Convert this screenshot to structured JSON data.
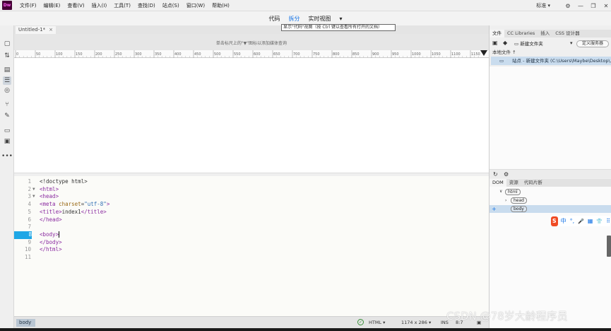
{
  "menubar": {
    "logo": "Dw",
    "items": [
      "文件(F)",
      "编辑(E)",
      "查看(V)",
      "插入(I)",
      "工具(T)",
      "查找(D)",
      "站点(S)",
      "窗口(W)",
      "帮助(H)"
    ],
    "workspace": "标准",
    "window_buttons": [
      "—",
      "❐",
      "✕"
    ]
  },
  "viewbar": {
    "code": "代码",
    "split": "拆分",
    "live": "实时视图",
    "tooltip": "显示\"代码\"视图（按 Ctrl 键以查看所有打开的文档）"
  },
  "document": {
    "tab": "Untitled-1*",
    "tab_close": "×",
    "mq_hint": "单击标尺上的\"▼\"图标以添加媒体查询",
    "ruler_ticks": [
      "0",
      "50",
      "100",
      "150",
      "200",
      "250",
      "300",
      "350",
      "400",
      "450",
      "500",
      "550",
      "600",
      "650",
      "700",
      "750",
      "800",
      "850",
      "900",
      "950",
      "1000",
      "1050",
      "1100",
      "1150"
    ]
  },
  "code": {
    "lines": [
      {
        "n": "1",
        "fold": "",
        "segments": [
          {
            "c": "t-text",
            "t": "<!doctype html>"
          }
        ]
      },
      {
        "n": "2",
        "fold": "▼",
        "segments": [
          {
            "c": "t-tag",
            "t": "<html>"
          }
        ]
      },
      {
        "n": "3",
        "fold": "▼",
        "segments": [
          {
            "c": "t-tag",
            "t": "<head>"
          }
        ]
      },
      {
        "n": "4",
        "fold": "",
        "segments": [
          {
            "c": "t-tag",
            "t": "<meta "
          },
          {
            "c": "t-attr",
            "t": "charset"
          },
          {
            "c": "t-text",
            "t": "="
          },
          {
            "c": "t-str",
            "t": "\"utf-8\""
          },
          {
            "c": "t-tag",
            "t": ">"
          }
        ]
      },
      {
        "n": "5",
        "fold": "",
        "segments": [
          {
            "c": "t-tag",
            "t": "<title>"
          },
          {
            "c": "t-text",
            "t": "index1"
          },
          {
            "c": "t-tag",
            "t": "</title>"
          }
        ]
      },
      {
        "n": "6",
        "fold": "",
        "segments": [
          {
            "c": "t-tag",
            "t": "</head>"
          }
        ]
      },
      {
        "n": "7",
        "fold": "",
        "segments": []
      },
      {
        "n": "8",
        "fold": "",
        "segments": [
          {
            "c": "t-tag",
            "t": "<body>"
          }
        ],
        "current": true
      },
      {
        "n": "9",
        "fold": "",
        "segments": [
          {
            "c": "t-tag",
            "t": "</body>"
          }
        ]
      },
      {
        "n": "10",
        "fold": "",
        "segments": [
          {
            "c": "t-tag",
            "t": "</html>"
          }
        ]
      },
      {
        "n": "11",
        "fold": "",
        "segments": []
      }
    ]
  },
  "statusbar": {
    "breadcrumb": "body",
    "language": "HTML",
    "size": "1174 x 286",
    "mode": "INS",
    "position": "8:7"
  },
  "watermark": "CSDN @78岁大龄程序员",
  "files_panel": {
    "tabs": [
      "文件",
      "CC Libraries",
      "插入",
      "CSS 设计器"
    ],
    "site_select": "新建文件夹",
    "define_server": "定义服务器",
    "local_files": "本地文件 ↑",
    "site_row": "站点 - 新建文件夹 (C:\\Users\\Maybe\\Desktop\\..."
  },
  "dom_panel": {
    "tabs": [
      "DOM",
      "资源",
      "代码片断"
    ],
    "nodes": [
      "html",
      "head",
      "body"
    ]
  },
  "ime": {
    "logo": "S",
    "items": [
      "中",
      "°,",
      "🎤",
      "▦",
      "👕",
      "⠿"
    ]
  }
}
